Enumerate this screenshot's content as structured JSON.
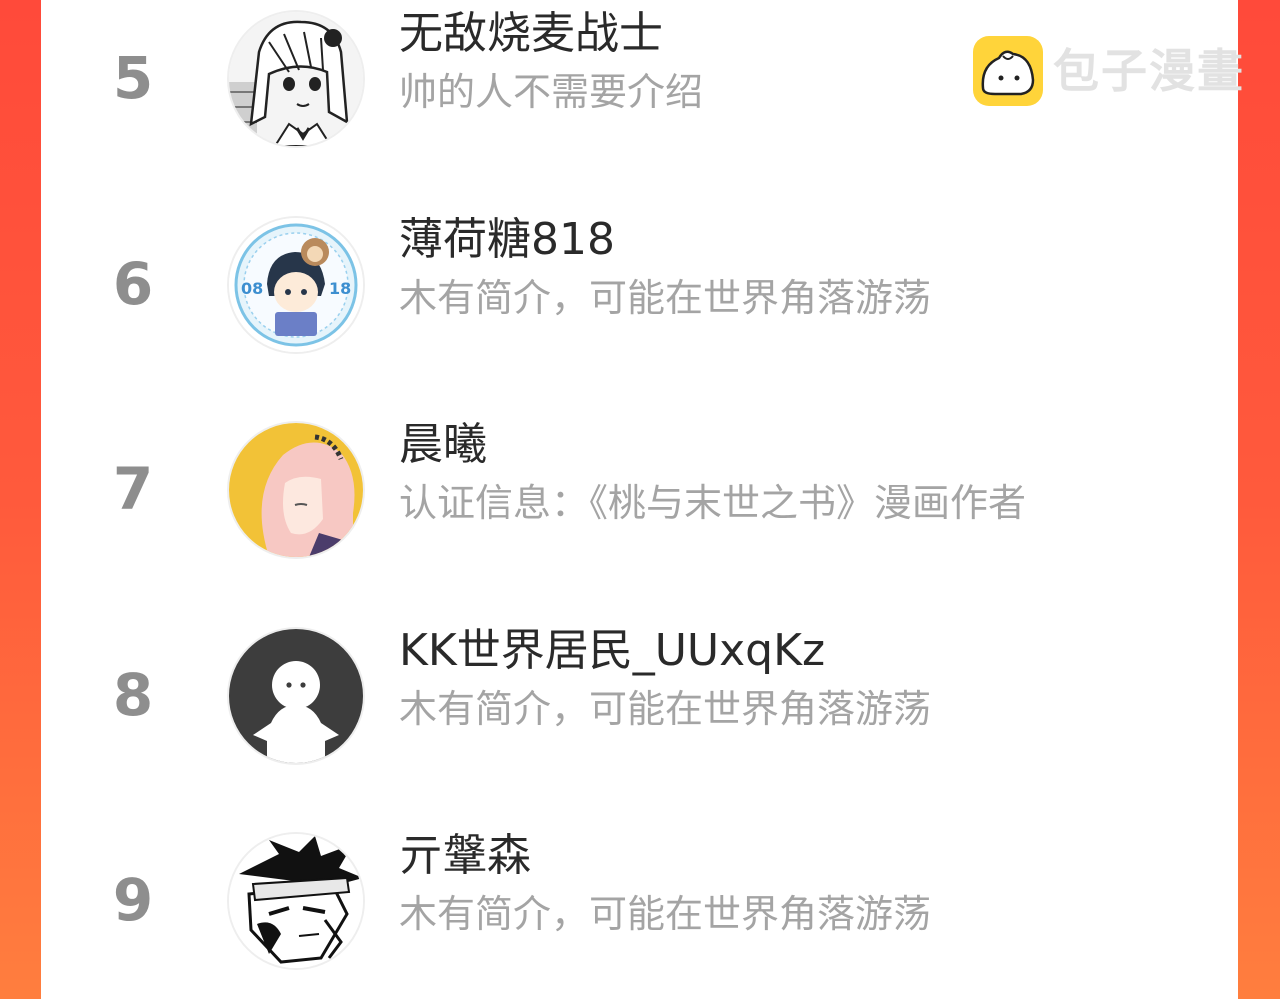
{
  "watermark": {
    "text": "包子漫畫",
    "icon": "bun-logo-icon"
  },
  "rows": [
    {
      "rank": "5",
      "name": "无敌烧麦战士",
      "bio": "帅的人不需要介绍",
      "avatar": "manga-girl-avatar"
    },
    {
      "rank": "6",
      "name": "薄荷糖818",
      "bio": "木有简介，可能在世界角落游荡",
      "avatar": "birthday-boy-avatar"
    },
    {
      "rank": "7",
      "name": "晨曦",
      "bio": "认证信息：《桃与末世之书》漫画作者",
      "avatar": "pink-hair-girl-avatar"
    },
    {
      "rank": "8",
      "name": "KK世界居民_UUxqKz",
      "bio": "木有简介，可能在世界角落游荡",
      "avatar": "default-ghost-avatar"
    },
    {
      "rank": "9",
      "name": "亓鞶森",
      "bio": "木有简介，可能在世界角落游荡",
      "avatar": "manga-boy-avatar"
    }
  ],
  "colors": {
    "accent_left": "#ff4a3a",
    "accent_right": "#ff7e3e",
    "rank_gray": "#8e8e8e",
    "bio_gray": "#a4a4a4",
    "watermark_yellow": "#ffd43a"
  }
}
